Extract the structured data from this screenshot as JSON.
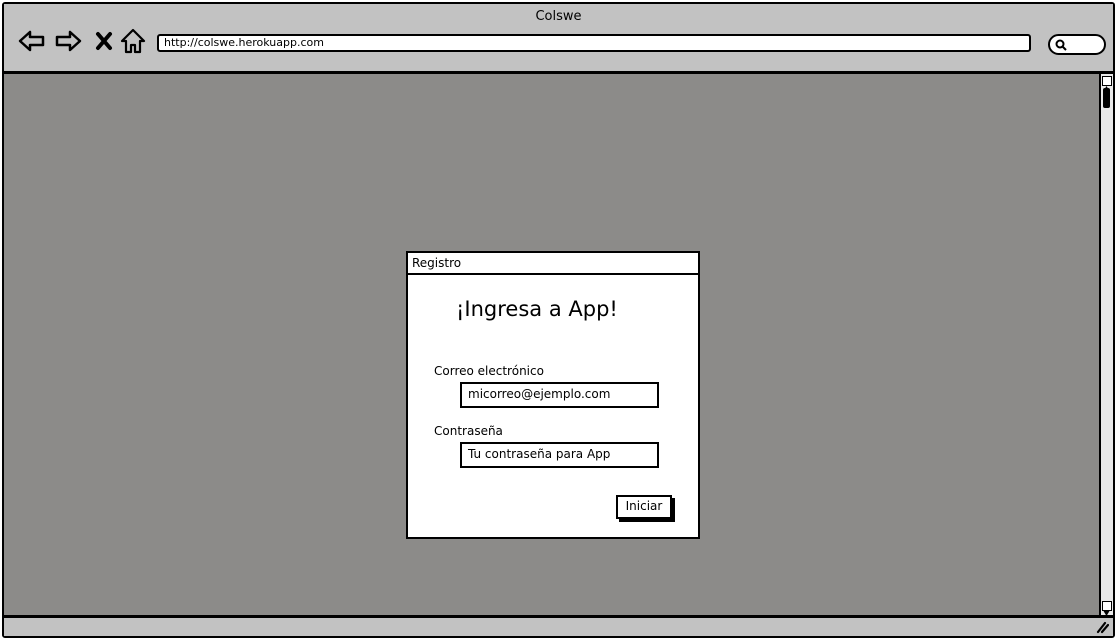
{
  "window": {
    "title": "Colswe"
  },
  "toolbar": {
    "back_icon": "back-arrow-icon",
    "forward_icon": "forward-arrow-icon",
    "stop_icon": "stop-x-icon",
    "home_icon": "home-icon",
    "url": "http://colswe.herokuapp.com",
    "search_icon": "search-icon"
  },
  "dialog": {
    "title": "Registro",
    "heading": "¡Ingresa a App!",
    "email_label": "Correo electrónico",
    "email_value": "micorreo@ejemplo.com",
    "password_label": "Contraseña",
    "password_value": "Tu contraseña para App",
    "submit_label": "Iniciar"
  },
  "colors": {
    "canvas": "#8c8b89",
    "chrome": "#c2c2c2"
  }
}
